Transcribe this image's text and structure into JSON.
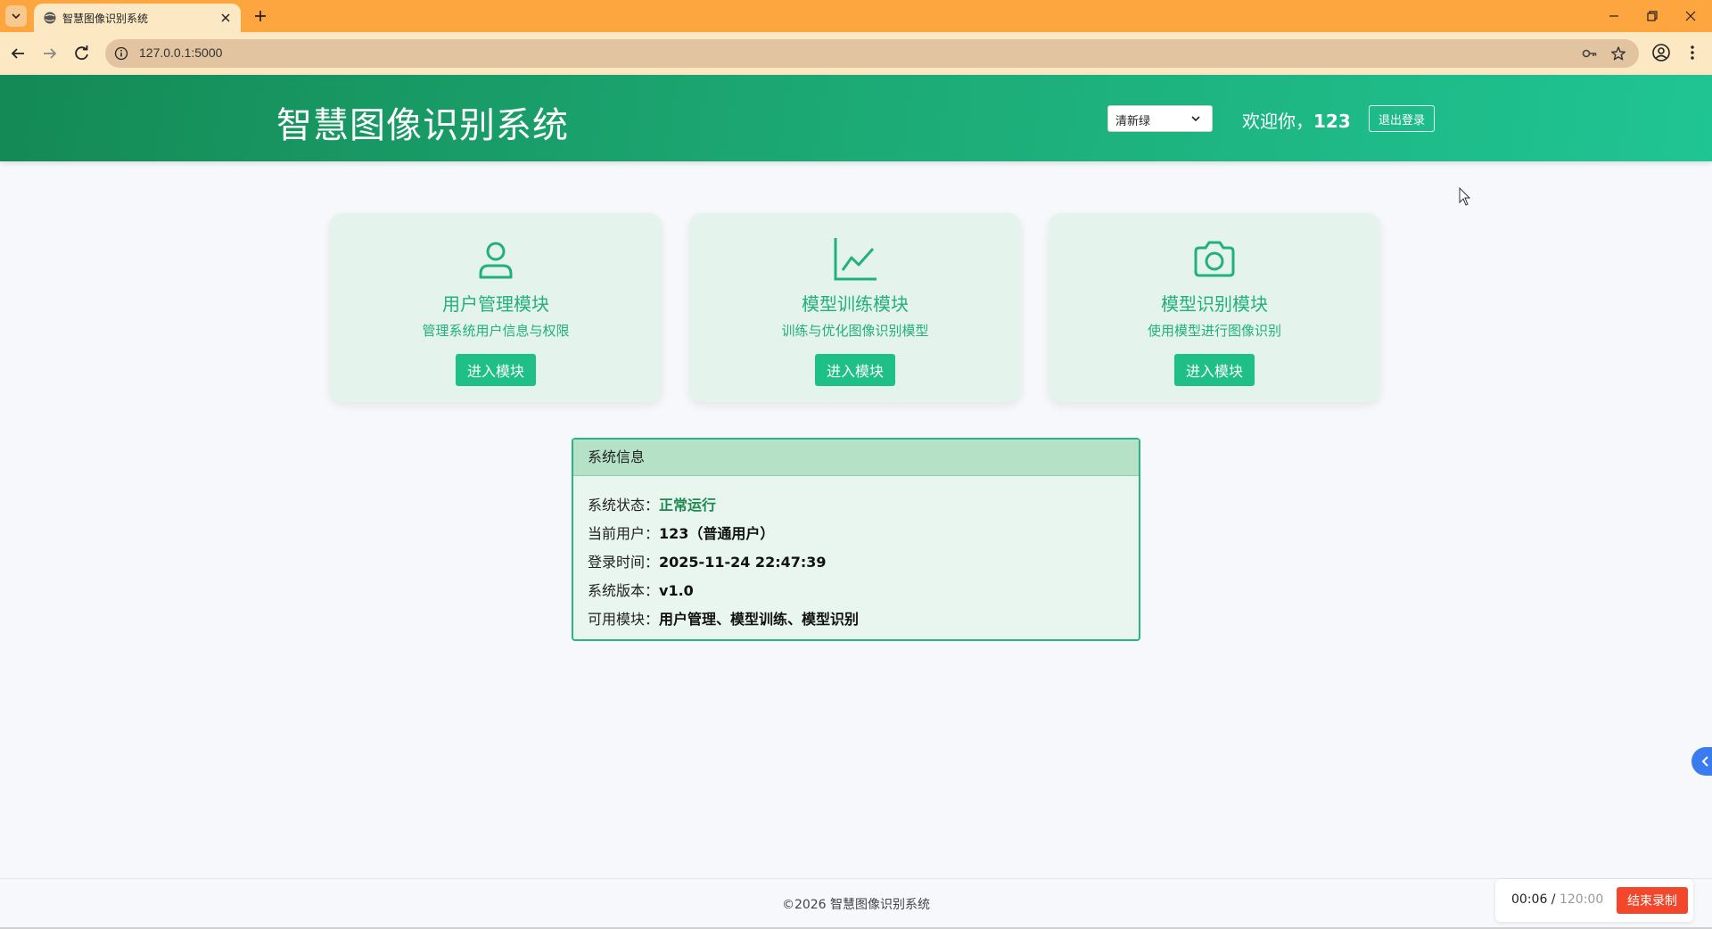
{
  "browser": {
    "tab_title": "智慧图像识别系统",
    "url": "127.0.0.1:5000"
  },
  "header": {
    "title": "智慧图像识别系统",
    "theme_selected": "清新绿",
    "welcome_prefix": "欢迎你，",
    "username": "123",
    "logout_label": "退出登录"
  },
  "modules": [
    {
      "icon": "user-icon",
      "title": "用户管理模块",
      "desc": "管理系统用户信息与权限",
      "button": "进入模块"
    },
    {
      "icon": "line-chart-icon",
      "title": "模型训练模块",
      "desc": "训练与优化图像识别模型",
      "button": "进入模块"
    },
    {
      "icon": "camera-icon",
      "title": "模型识别模块",
      "desc": "使用模型进行图像识别",
      "button": "进入模块"
    }
  ],
  "system_info": {
    "heading": "系统信息",
    "rows": [
      {
        "label": "系统状态：",
        "value": "正常运行"
      },
      {
        "label": "当前用户：",
        "value": "123（普通用户）"
      },
      {
        "label": "登录时间：",
        "value": "2025-11-24 22:47:39"
      },
      {
        "label": "系统版本：",
        "value": "v1.0"
      },
      {
        "label": "可用模块：",
        "value": "用户管理、模型训练、模型识别"
      }
    ]
  },
  "footer": {
    "copyright": "©2026 智慧图像识别系统"
  },
  "recorder": {
    "elapsed": "00:06",
    "separator": " / ",
    "total": "120:00",
    "stop_label": "结束录制"
  },
  "colors": {
    "brand_green": "#1ca772",
    "accent_green": "#22b07c",
    "status_ok": "#1e8a4f",
    "stop_red": "#f2472b"
  }
}
